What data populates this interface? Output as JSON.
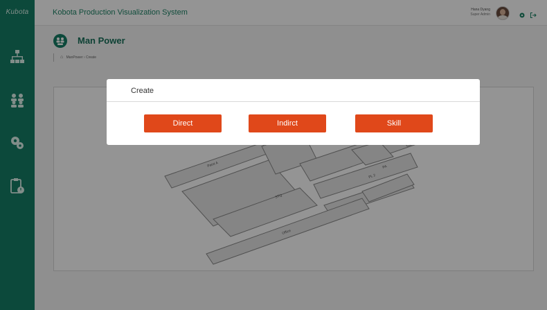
{
  "sidebar": {
    "logo": "Kubota",
    "items": [
      {
        "icon": "hierarchy-icon"
      },
      {
        "icon": "team-icon"
      },
      {
        "icon": "wrench-gear-icon"
      },
      {
        "icon": "clipboard-clock-icon"
      }
    ]
  },
  "header": {
    "title": "Kobota Production Visualization System",
    "user_name": "Hana Dyang",
    "user_role": "Super Admin",
    "icons": [
      "settings-icon",
      "logout-icon"
    ]
  },
  "page": {
    "title": "Man Power",
    "breadcrumb": "ManPower › Create"
  },
  "map_labels": {
    "zone_a": "Paint A",
    "pl2": "PL 2",
    "pa": "PA",
    "office": "Office",
    "stq": "STQ"
  },
  "dialog": {
    "title": "Create",
    "buttons": {
      "direct": "Direct",
      "indirect": "Indirct",
      "skill": "Skill"
    }
  },
  "colors": {
    "sidebar": "#167e66",
    "accent_text": "#1d8467",
    "button": "#e0481a"
  }
}
